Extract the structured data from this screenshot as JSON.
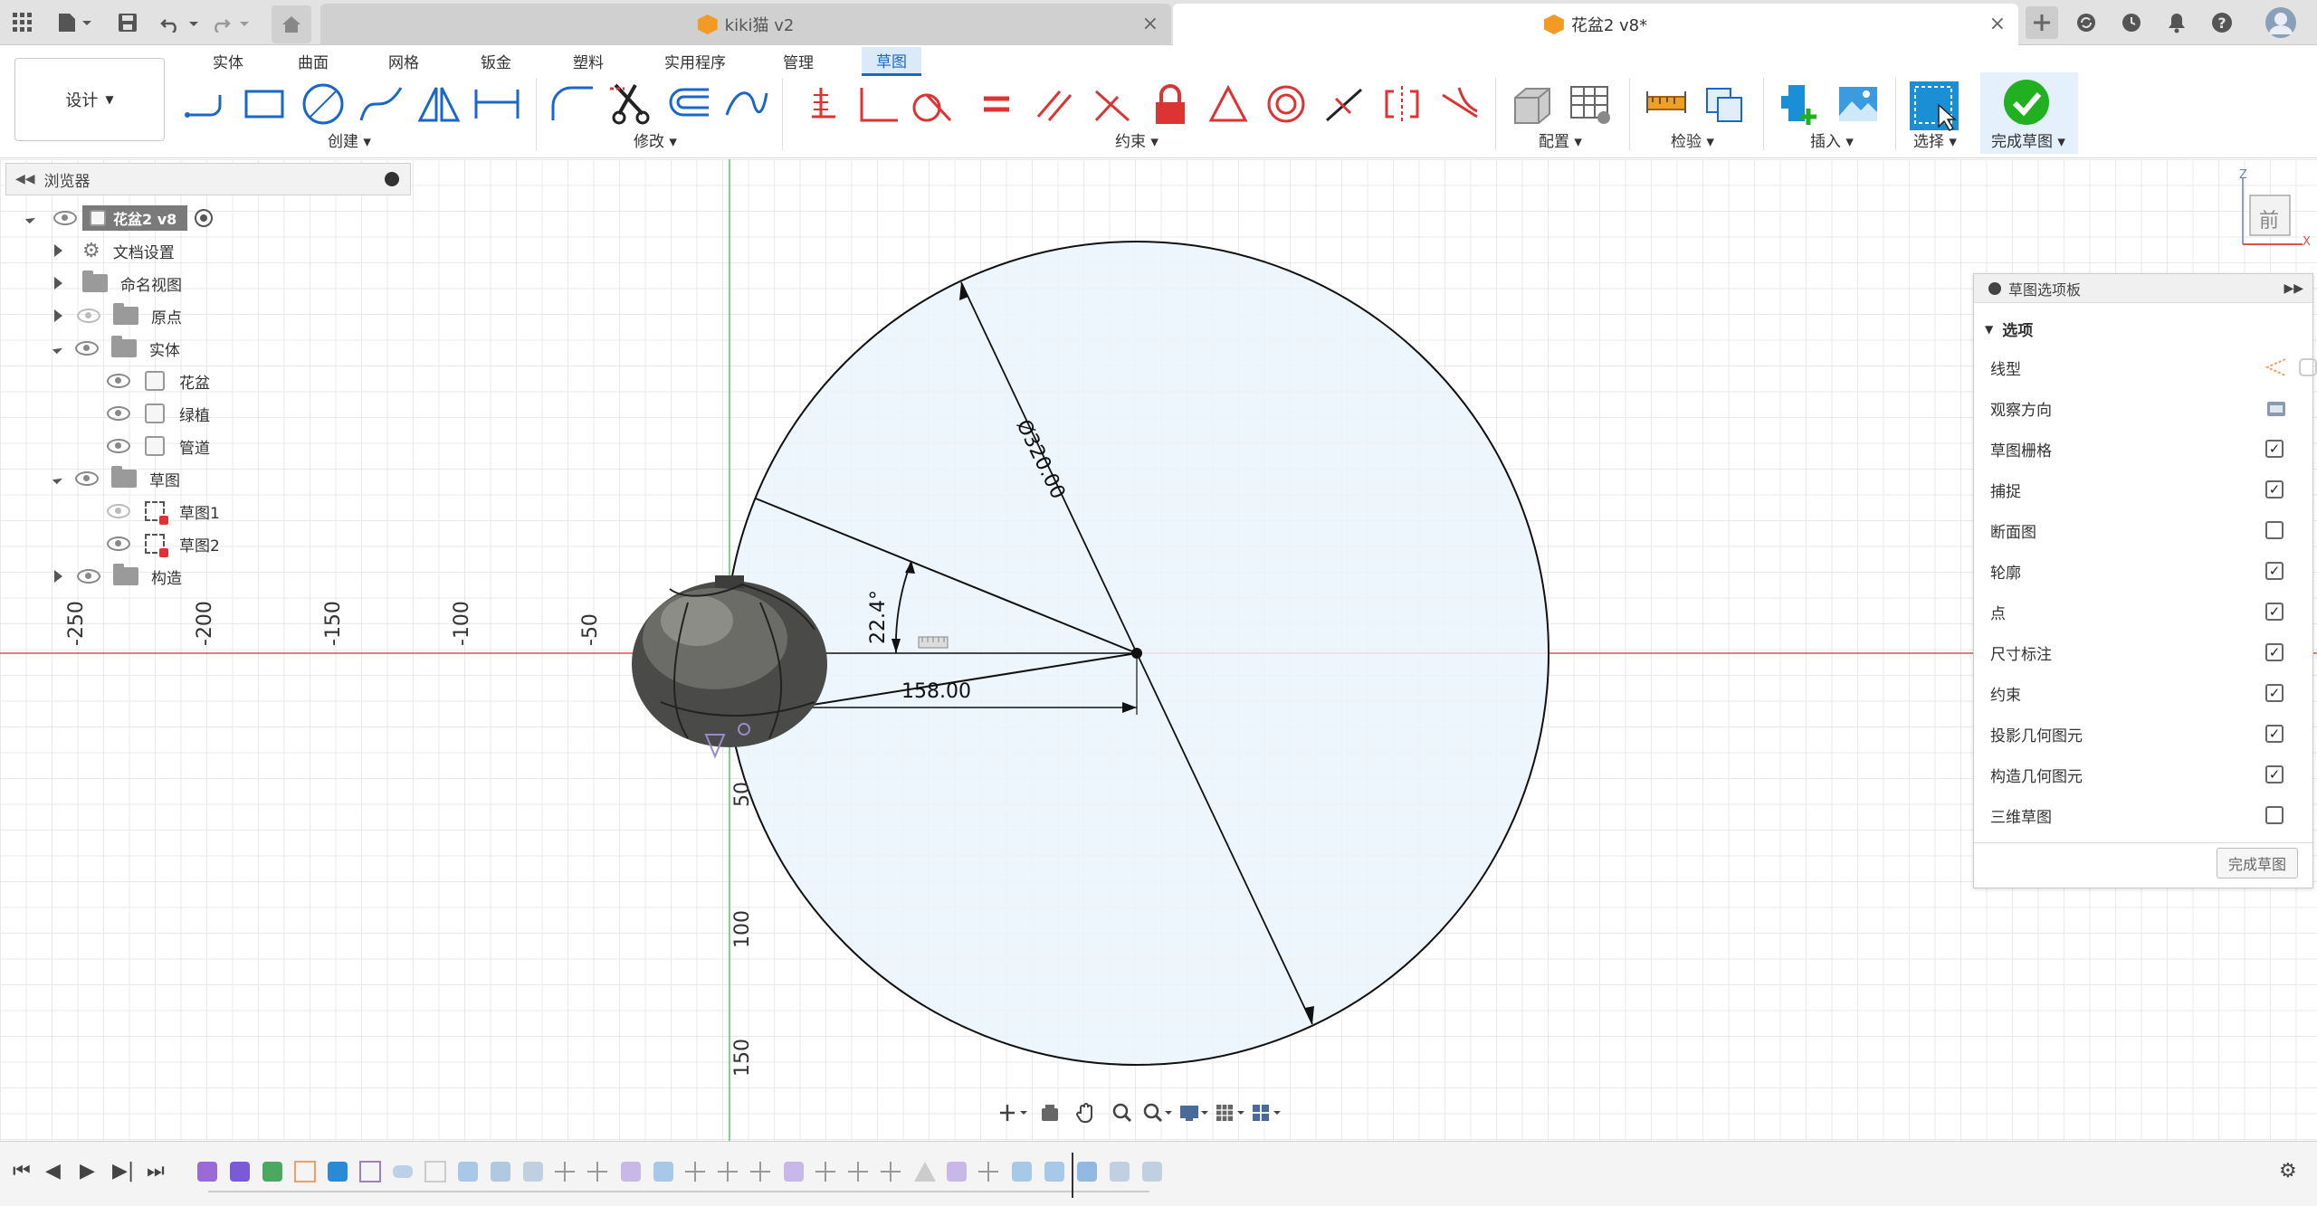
{
  "app": {
    "tabs": [
      {
        "label": "kiki猫 v2",
        "close": "×"
      },
      {
        "label": "花盆2 v8*",
        "close": "×"
      }
    ],
    "toolbar_icons": [
      "grid-icon",
      "file-icon",
      "save-icon",
      "undo-icon",
      "redo-icon",
      "home-icon"
    ],
    "right_icons": [
      "plus-icon",
      "sync-icon",
      "history-icon",
      "bell-icon",
      "help-icon",
      "avatar"
    ]
  },
  "ribbon": {
    "design_label": "设计",
    "tabs": [
      "实体",
      "曲面",
      "网格",
      "钣金",
      "塑料",
      "实用程序",
      "管理",
      "草图"
    ],
    "active_tab": "草图",
    "groups": {
      "create": "创建",
      "modify": "修改",
      "constrain": "约束",
      "configure": "配置",
      "inspect": "检验",
      "insert": "插入",
      "select": "选择",
      "finish": "完成草图"
    }
  },
  "browser": {
    "title": "浏览器",
    "root": "花盆2 v8",
    "items": [
      {
        "label": "文档设置"
      },
      {
        "label": "命名视图"
      },
      {
        "label": "原点"
      },
      {
        "label": "实体"
      },
      {
        "label": "花盆"
      },
      {
        "label": "绿植"
      },
      {
        "label": "管道"
      },
      {
        "label": "草图"
      },
      {
        "label": "草图1"
      },
      {
        "label": "草图2"
      },
      {
        "label": "构造"
      }
    ]
  },
  "sketch": {
    "diameter_dim": "Ø320.00",
    "angle_dim": "22.4°",
    "length_dim": "158.00",
    "x_ticks": [
      "-250",
      "-200",
      "-150",
      "-100",
      "-50"
    ],
    "y_ticks": [
      "50",
      "100",
      "150"
    ],
    "view_cube": {
      "label": "前",
      "axis_z": "Z",
      "axis_x": "X"
    }
  },
  "palette": {
    "title": "草图选项板",
    "section": "选项",
    "rows": [
      {
        "label": "线型",
        "type": "icons"
      },
      {
        "label": "观察方向",
        "type": "icon"
      },
      {
        "label": "草图栅格",
        "checked": true
      },
      {
        "label": "捕捉",
        "checked": true
      },
      {
        "label": "断面图",
        "checked": false
      },
      {
        "label": "轮廓",
        "checked": true
      },
      {
        "label": "点",
        "checked": true
      },
      {
        "label": "尺寸标注",
        "checked": true
      },
      {
        "label": "约束",
        "checked": true
      },
      {
        "label": "投影几何图元",
        "checked": true
      },
      {
        "label": "构造几何图元",
        "checked": true
      },
      {
        "label": "三维草图",
        "checked": false
      }
    ],
    "finish_button": "完成草图"
  },
  "colors": {
    "accent": "#1a67c9",
    "axis_red": "#e05050",
    "axis_green": "#60c060",
    "profile_fill": "#eaf4fc",
    "finish_green": "#20b020"
  }
}
